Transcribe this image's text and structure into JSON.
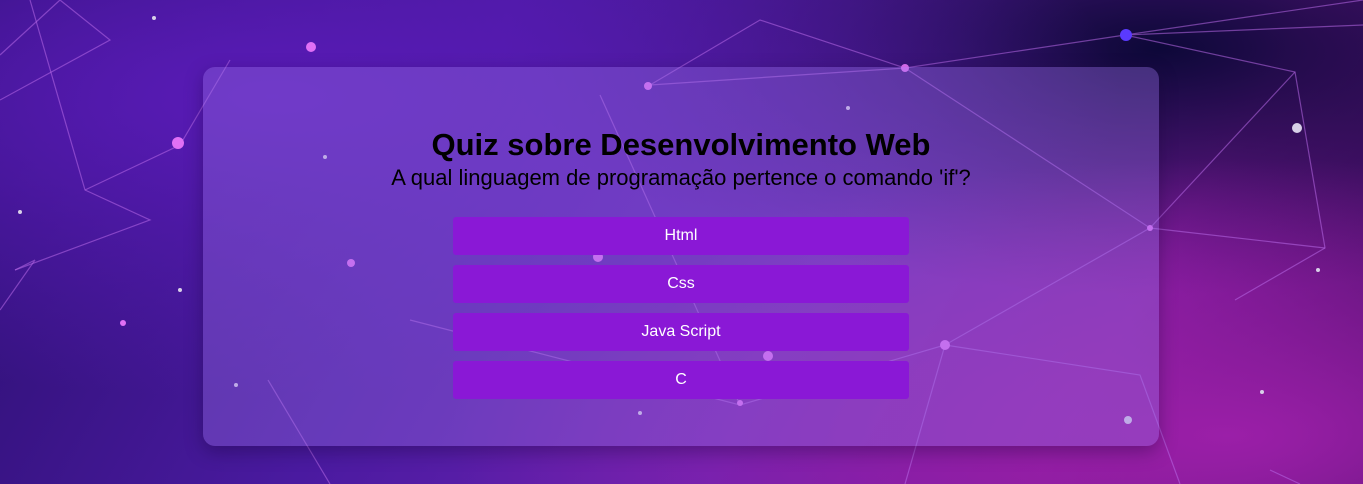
{
  "quiz": {
    "title": "Quiz sobre Desenvolvimento Web",
    "question": "A qual linguagem de programação pertence o comando 'if'?",
    "answers": [
      {
        "label": "Html"
      },
      {
        "label": "Css"
      },
      {
        "label": "Java Script"
      },
      {
        "label": "C"
      }
    ]
  },
  "colors": {
    "button": "#8a18d6",
    "button_text": "#ffffff",
    "title_text": "#000000"
  }
}
